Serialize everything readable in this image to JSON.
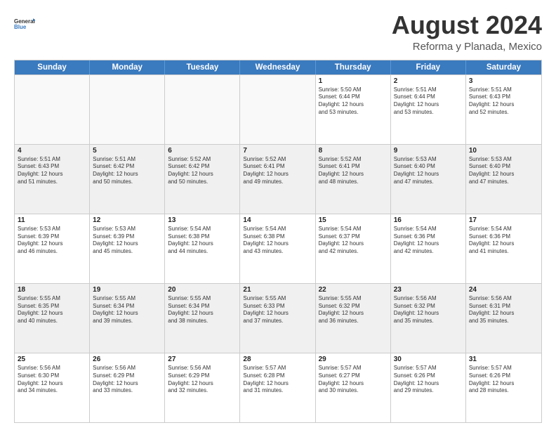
{
  "header": {
    "logo_general": "General",
    "logo_blue": "Blue",
    "main_title": "August 2024",
    "subtitle": "Reforma y Planada, Mexico"
  },
  "days_of_week": [
    "Sunday",
    "Monday",
    "Tuesday",
    "Wednesday",
    "Thursday",
    "Friday",
    "Saturday"
  ],
  "weeks": [
    [
      {
        "day": "",
        "info": ""
      },
      {
        "day": "",
        "info": ""
      },
      {
        "day": "",
        "info": ""
      },
      {
        "day": "",
        "info": ""
      },
      {
        "day": "1",
        "info": "Sunrise: 5:50 AM\nSunset: 6:44 PM\nDaylight: 12 hours\nand 53 minutes."
      },
      {
        "day": "2",
        "info": "Sunrise: 5:51 AM\nSunset: 6:44 PM\nDaylight: 12 hours\nand 53 minutes."
      },
      {
        "day": "3",
        "info": "Sunrise: 5:51 AM\nSunset: 6:43 PM\nDaylight: 12 hours\nand 52 minutes."
      }
    ],
    [
      {
        "day": "4",
        "info": "Sunrise: 5:51 AM\nSunset: 6:43 PM\nDaylight: 12 hours\nand 51 minutes."
      },
      {
        "day": "5",
        "info": "Sunrise: 5:51 AM\nSunset: 6:42 PM\nDaylight: 12 hours\nand 50 minutes."
      },
      {
        "day": "6",
        "info": "Sunrise: 5:52 AM\nSunset: 6:42 PM\nDaylight: 12 hours\nand 50 minutes."
      },
      {
        "day": "7",
        "info": "Sunrise: 5:52 AM\nSunset: 6:41 PM\nDaylight: 12 hours\nand 49 minutes."
      },
      {
        "day": "8",
        "info": "Sunrise: 5:52 AM\nSunset: 6:41 PM\nDaylight: 12 hours\nand 48 minutes."
      },
      {
        "day": "9",
        "info": "Sunrise: 5:53 AM\nSunset: 6:40 PM\nDaylight: 12 hours\nand 47 minutes."
      },
      {
        "day": "10",
        "info": "Sunrise: 5:53 AM\nSunset: 6:40 PM\nDaylight: 12 hours\nand 47 minutes."
      }
    ],
    [
      {
        "day": "11",
        "info": "Sunrise: 5:53 AM\nSunset: 6:39 PM\nDaylight: 12 hours\nand 46 minutes."
      },
      {
        "day": "12",
        "info": "Sunrise: 5:53 AM\nSunset: 6:39 PM\nDaylight: 12 hours\nand 45 minutes."
      },
      {
        "day": "13",
        "info": "Sunrise: 5:54 AM\nSunset: 6:38 PM\nDaylight: 12 hours\nand 44 minutes."
      },
      {
        "day": "14",
        "info": "Sunrise: 5:54 AM\nSunset: 6:38 PM\nDaylight: 12 hours\nand 43 minutes."
      },
      {
        "day": "15",
        "info": "Sunrise: 5:54 AM\nSunset: 6:37 PM\nDaylight: 12 hours\nand 42 minutes."
      },
      {
        "day": "16",
        "info": "Sunrise: 5:54 AM\nSunset: 6:36 PM\nDaylight: 12 hours\nand 42 minutes."
      },
      {
        "day": "17",
        "info": "Sunrise: 5:54 AM\nSunset: 6:36 PM\nDaylight: 12 hours\nand 41 minutes."
      }
    ],
    [
      {
        "day": "18",
        "info": "Sunrise: 5:55 AM\nSunset: 6:35 PM\nDaylight: 12 hours\nand 40 minutes."
      },
      {
        "day": "19",
        "info": "Sunrise: 5:55 AM\nSunset: 6:34 PM\nDaylight: 12 hours\nand 39 minutes."
      },
      {
        "day": "20",
        "info": "Sunrise: 5:55 AM\nSunset: 6:34 PM\nDaylight: 12 hours\nand 38 minutes."
      },
      {
        "day": "21",
        "info": "Sunrise: 5:55 AM\nSunset: 6:33 PM\nDaylight: 12 hours\nand 37 minutes."
      },
      {
        "day": "22",
        "info": "Sunrise: 5:55 AM\nSunset: 6:32 PM\nDaylight: 12 hours\nand 36 minutes."
      },
      {
        "day": "23",
        "info": "Sunrise: 5:56 AM\nSunset: 6:32 PM\nDaylight: 12 hours\nand 35 minutes."
      },
      {
        "day": "24",
        "info": "Sunrise: 5:56 AM\nSunset: 6:31 PM\nDaylight: 12 hours\nand 35 minutes."
      }
    ],
    [
      {
        "day": "25",
        "info": "Sunrise: 5:56 AM\nSunset: 6:30 PM\nDaylight: 12 hours\nand 34 minutes."
      },
      {
        "day": "26",
        "info": "Sunrise: 5:56 AM\nSunset: 6:29 PM\nDaylight: 12 hours\nand 33 minutes."
      },
      {
        "day": "27",
        "info": "Sunrise: 5:56 AM\nSunset: 6:29 PM\nDaylight: 12 hours\nand 32 minutes."
      },
      {
        "day": "28",
        "info": "Sunrise: 5:57 AM\nSunset: 6:28 PM\nDaylight: 12 hours\nand 31 minutes."
      },
      {
        "day": "29",
        "info": "Sunrise: 5:57 AM\nSunset: 6:27 PM\nDaylight: 12 hours\nand 30 minutes."
      },
      {
        "day": "30",
        "info": "Sunrise: 5:57 AM\nSunset: 6:26 PM\nDaylight: 12 hours\nand 29 minutes."
      },
      {
        "day": "31",
        "info": "Sunrise: 5:57 AM\nSunset: 6:26 PM\nDaylight: 12 hours\nand 28 minutes."
      }
    ]
  ]
}
